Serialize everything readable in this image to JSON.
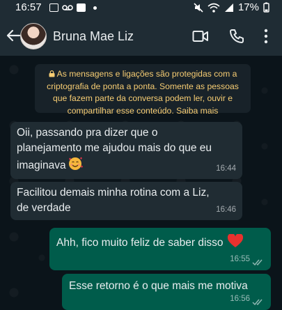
{
  "status_bar": {
    "time": "16:57",
    "battery": "17%"
  },
  "header": {
    "contact_name": "Bruna Mae Liz"
  },
  "encryption_notice": {
    "line1": "As mensagens e ligações são protegidas com a",
    "line2": "criptografia de ponta a ponta. Somente as pessoas",
    "line3": "que fazem parte da conversa podem ler, ouvir e",
    "line4": "compartilhar esse conteúdo. Saiba mais"
  },
  "messages": [
    {
      "direction": "incoming",
      "lines": [
        "Oii, passando pra dizer que o",
        "planejamento me ajudou mais do que eu",
        "imaginava"
      ],
      "emoji": "smiling-face-with-hearts",
      "time": "16:44"
    },
    {
      "direction": "incoming",
      "lines": [
        "Facilitou demais minha rotina com a Liz,",
        "de verdade"
      ],
      "time": "16:46"
    },
    {
      "direction": "outgoing",
      "lines": [
        "Ahh, fico muito feliz de saber disso"
      ],
      "emoji": "red-heart",
      "time": "16:55",
      "status": "read"
    },
    {
      "direction": "outgoing",
      "lines": [
        "Esse retorno é o que mais me motiva"
      ],
      "time": "16:56",
      "status": "read"
    }
  ],
  "colors": {
    "header_bg": "#1f2c34",
    "chat_bg": "#0b141a",
    "incoming_bubble": "#202c33",
    "outgoing_bubble": "#005c4b",
    "notice_text": "#f7cd73",
    "read_ticks": "#53bdeb"
  }
}
